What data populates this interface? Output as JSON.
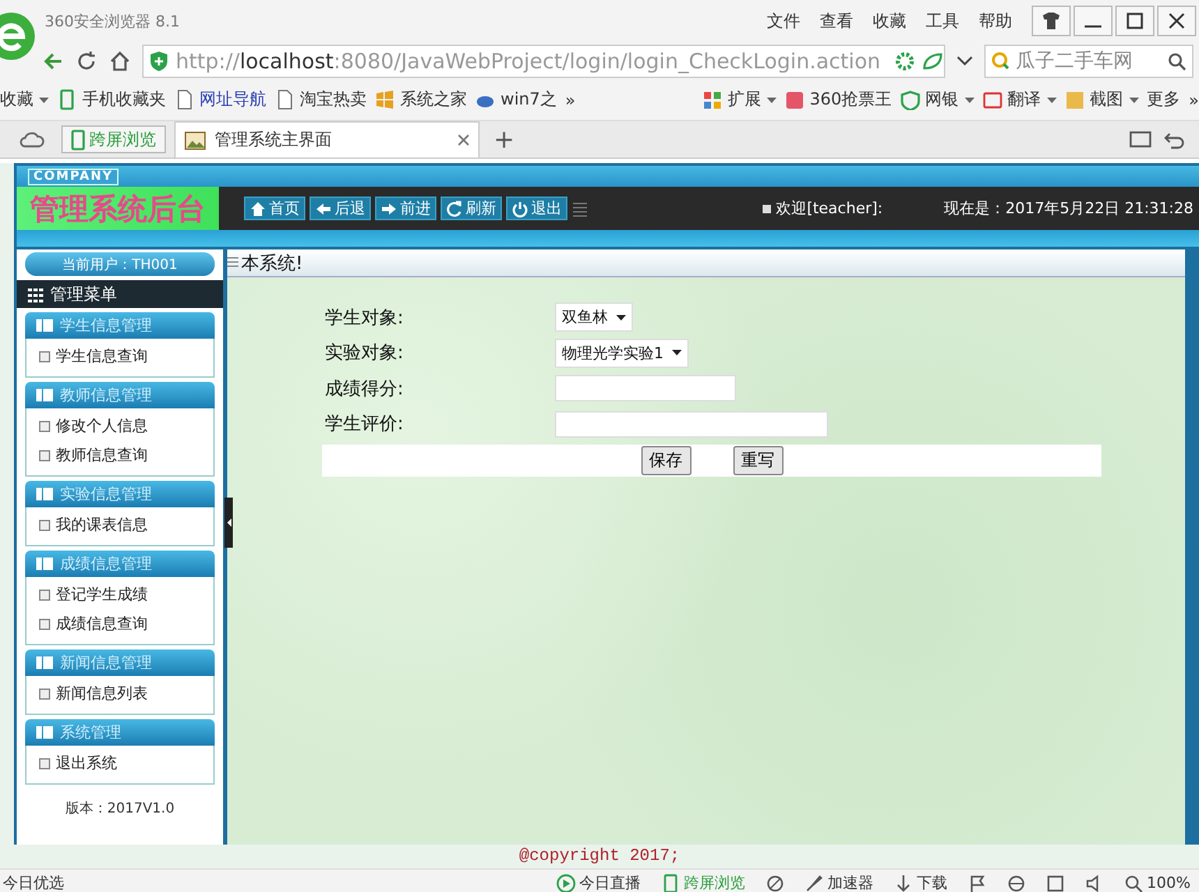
{
  "browser": {
    "title": "360安全浏览器 8.1",
    "menu": [
      "文件",
      "查看",
      "收藏",
      "工具",
      "帮助"
    ],
    "address": {
      "url": "http://**localhost**:8080/JavaWebProject/login/login_CheckLogin.action",
      "search": "瓜子二手车网"
    },
    "bookmarks": {
      "left": [
        {
          "label": "收藏",
          "dropdown": true
        },
        {
          "label": "手机收藏夹",
          "dropdown": false
        },
        {
          "label": "网址导航",
          "dropdown": false
        },
        {
          "label": "淘宝热卖",
          "dropdown": false
        },
        {
          "label": "系统之家",
          "dropdown": false
        },
        {
          "label": "win7之",
          "dropdown": false
        }
      ],
      "left_more": "»",
      "right": [
        {
          "label": "扩展",
          "dropdown": true
        },
        {
          "label": "360抢票王",
          "dropdown": false
        },
        {
          "label": "网银",
          "dropdown": true
        },
        {
          "label": "翻译",
          "dropdown": true
        },
        {
          "label": "截图",
          "dropdown": true
        },
        {
          "label": "更多",
          "dropdown": false
        }
      ],
      "right_more": "»"
    },
    "cross_screen": "跨屏浏览",
    "tabs": [
      {
        "label": "管理系统主界面",
        "selected": true
      }
    ],
    "new_tab": "+"
  },
  "header": {
    "company": "COMPANY",
    "title": "管理系统后台",
    "nav": [
      "首页",
      "后退",
      "前进",
      "刷新",
      "退出"
    ],
    "welcome": "欢迎[teacher]:",
    "time": "现在是：2017年5月22日 21:31:28"
  },
  "sidebar": {
    "user": "当前用户：TH001",
    "menu_title": "管理菜单",
    "groups": [
      {
        "title": "学生信息管理",
        "items": [
          "学生信息查询"
        ]
      },
      {
        "title": "教师信息管理",
        "items": [
          "修改个人信息",
          "教师信息查询"
        ]
      },
      {
        "title": "实验信息管理",
        "items": [
          "我的课表信息"
        ]
      },
      {
        "title": "成绩信息管理",
        "items": [
          "登记学生成绩",
          "成绩信息查询"
        ]
      },
      {
        "title": "新闻信息管理",
        "items": [
          "新闻信息列表"
        ]
      },
      {
        "title": "系统管理",
        "items": [
          "退出系统"
        ]
      }
    ],
    "version": "版本：2017V1.0"
  },
  "main": {
    "breadcrumb": "本系统!",
    "fields": [
      {
        "label": "学生对象:",
        "kind": "select",
        "value": "双鱼林"
      },
      {
        "label": "实验对象:",
        "kind": "select",
        "value": "物理光学实验1"
      },
      {
        "label": "成绩得分:",
        "kind": "text"
      },
      {
        "label": "学生评价:",
        "kind": "wide_text"
      }
    ],
    "buttons": [
      "保存",
      "重写"
    ]
  },
  "footer": "@copyright 2017;",
  "status_bar": {
    "left": "今日优选",
    "items": [
      "今日直播",
      "跨屏浏览",
      "加速器",
      "下载"
    ],
    "zoom": "100%"
  }
}
